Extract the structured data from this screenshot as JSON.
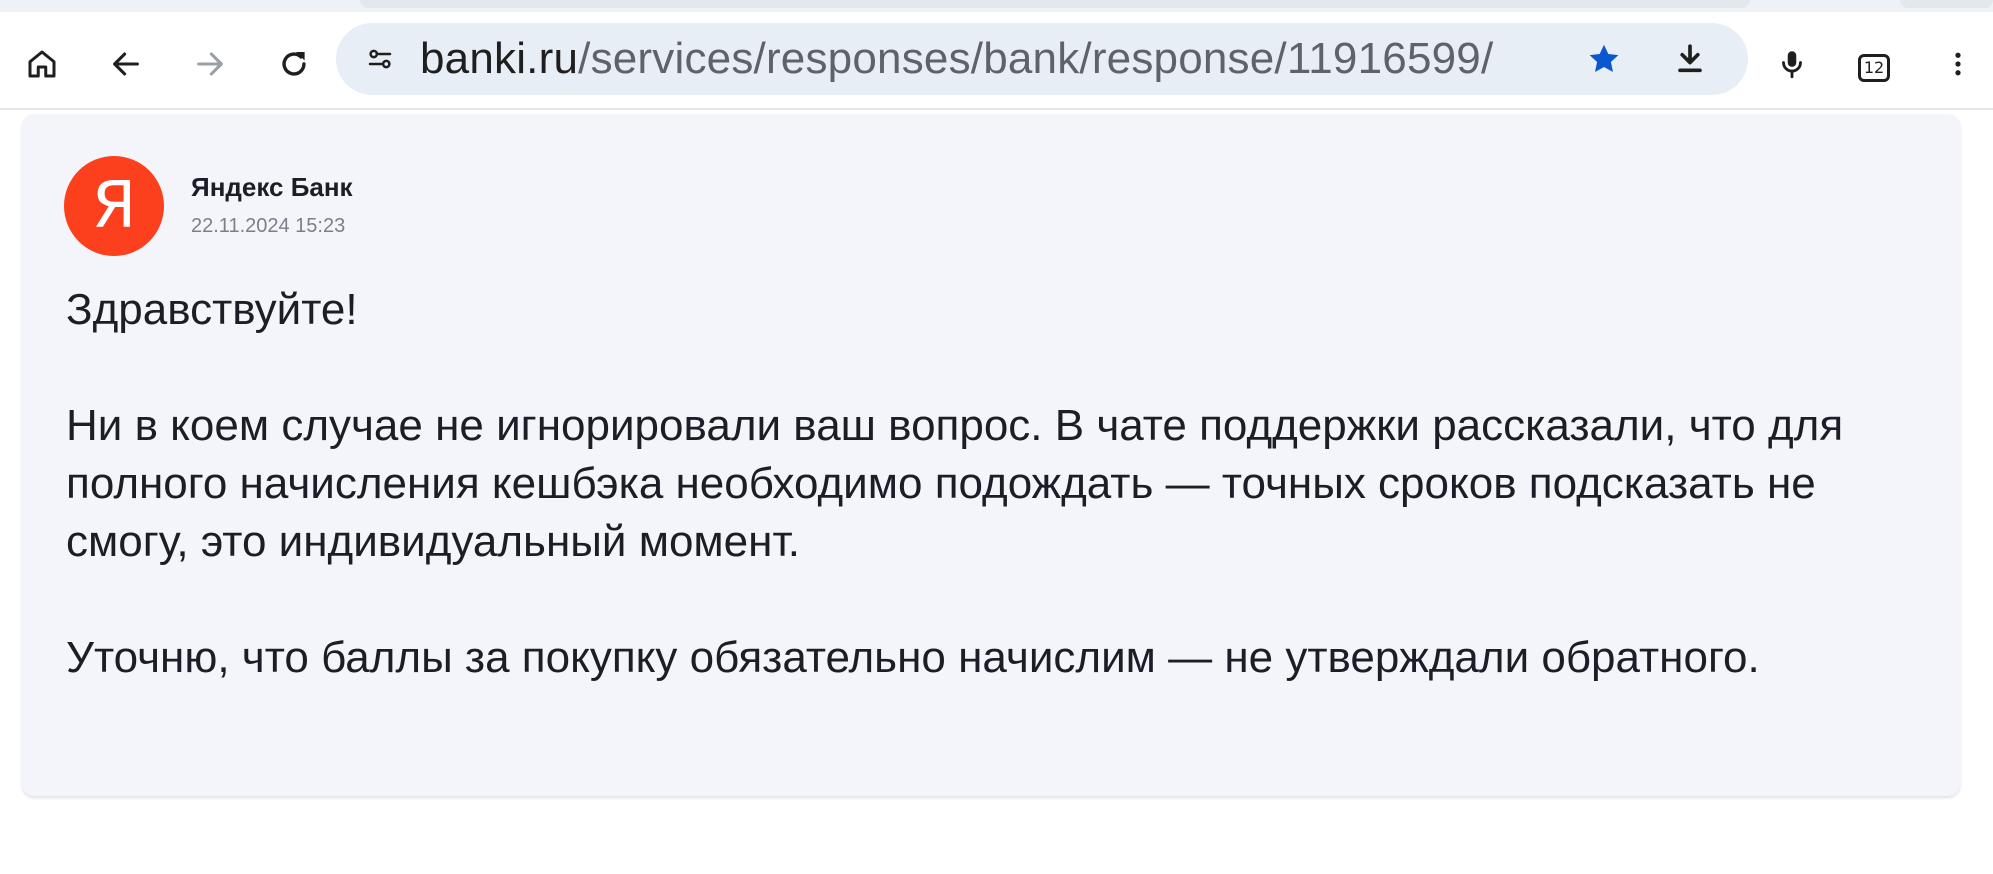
{
  "browser": {
    "url_host": "banki.ru",
    "url_path": "/services/responses/bank/response/11916599/",
    "tab_count": "12",
    "icons": {
      "home": "home-icon",
      "back": "back-arrow-icon",
      "forward": "forward-arrow-icon",
      "reload": "reload-icon",
      "site_settings": "tune-icon",
      "bookmark": "star-icon",
      "download": "download-icon",
      "voice": "microphone-icon",
      "menu": "more-vert-icon"
    },
    "accent_color": "#0b57d0"
  },
  "response": {
    "bank_name": "Яндекс Банк",
    "avatar_letter": "Я",
    "avatar_color": "#fc3f1d",
    "date": "22.11.2024 15:23",
    "paragraphs": [
      "Здравствуйте!",
      "Ни в коем случае не игнорировали ваш вопрос. В чате поддержки рассказали, что для полного начисления кешбэка необходимо подождать — точных сроков подсказать не смогу, это индивидуальный момент.",
      "Уточню, что баллы за покупку обязательно начислим — не утверждали обратного."
    ]
  }
}
